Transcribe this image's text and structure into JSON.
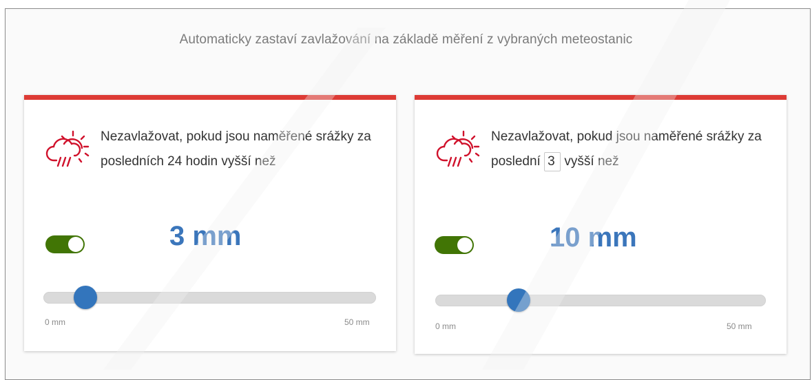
{
  "header": {
    "subtitle": "Automaticky zastaví zavlažování na základě měření z vybraných meteostanic"
  },
  "colors": {
    "card_accent": "#dd3b35",
    "toggle_on": "#417505",
    "value_text": "#3b76bb",
    "slider_knob": "#3375bc",
    "icon": "#d0112b"
  },
  "rules": [
    {
      "icon": "rain-sun-icon",
      "text": "Nezavlažovat, pokud jsou naměřené srážky za posledních 24 hodin vyšší než",
      "enabled": true,
      "value_label": "3 mm",
      "value": 3,
      "slider": {
        "min_label": "0 mm",
        "max_label": "50 mm",
        "min": 0,
        "max": 50
      }
    },
    {
      "icon": "rain-sun-icon",
      "text_before": "Nezavlažovat, pokud jsou naměřené srážky za poslední",
      "days_value": "3",
      "text_after": "vyšší než",
      "enabled": true,
      "value_label": "10 mm",
      "value": 10,
      "slider": {
        "min_label": "0 mm",
        "max_label": "50 mm",
        "min": 0,
        "max": 50
      }
    }
  ]
}
